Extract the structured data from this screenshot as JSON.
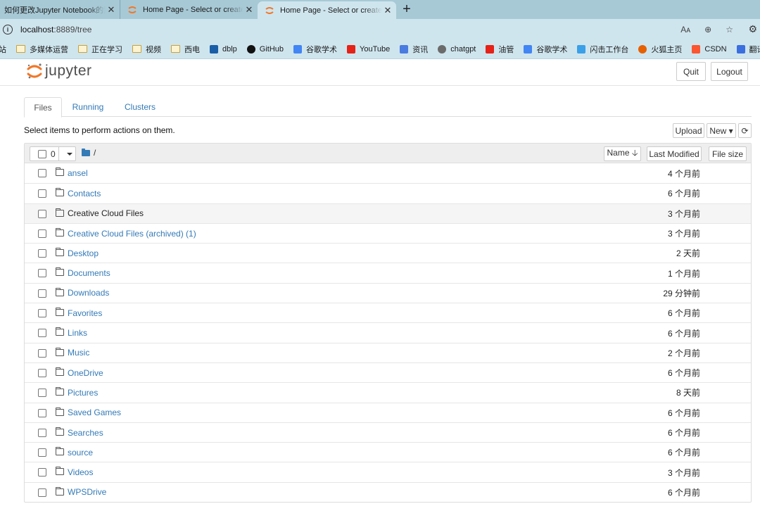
{
  "browser": {
    "tabs": [
      {
        "title": "如何更改Jupyter Notebook的默认",
        "active": false
      },
      {
        "title": "Home Page - Select or create a n",
        "active": false
      },
      {
        "title": "Home Page - Select or create a n",
        "active": true
      }
    ],
    "close_glyph": "✕",
    "new_tab_glyph": "+",
    "address": {
      "host": "localhost",
      "path": ":8889/tree"
    },
    "addr_icons": [
      "read-aloud-icon",
      "zoom-icon",
      "favorite-star-icon",
      "extensions-icon"
    ],
    "addr_glyphs": {
      "read_aloud": "Aᴀ",
      "zoom": "⊕",
      "favorite": "☆",
      "extensions": "⚙"
    },
    "bookmarks": [
      {
        "label": "站",
        "icon": "site-icon"
      },
      {
        "label": "多媒体运营",
        "icon": "folder-icon"
      },
      {
        "label": "正在学习",
        "icon": "folder-icon"
      },
      {
        "label": "视频",
        "icon": "folder-icon"
      },
      {
        "label": "西电",
        "icon": "folder-icon"
      },
      {
        "label": "dblp",
        "icon": "dblp-icon"
      },
      {
        "label": "GitHub",
        "icon": "github-icon"
      },
      {
        "label": "谷歌学术",
        "icon": "scholar-icon"
      },
      {
        "label": "YouTube",
        "icon": "youtube-icon"
      },
      {
        "label": "资讯",
        "icon": "news-icon"
      },
      {
        "label": "chatgpt",
        "icon": "chatgpt-icon"
      },
      {
        "label": "油管",
        "icon": "youtube-icon"
      },
      {
        "label": "谷歌学术",
        "icon": "scholar-icon"
      },
      {
        "label": "闪击工作台",
        "icon": "flash-icon"
      },
      {
        "label": "火狐主页",
        "icon": "firefox-icon"
      },
      {
        "label": "CSDN",
        "icon": "csdn-icon"
      },
      {
        "label": "翻译",
        "icon": "translate-icon"
      }
    ]
  },
  "header": {
    "logo_text": "jupyter",
    "quit_label": "Quit",
    "logout_label": "Logout"
  },
  "nav": {
    "files": "Files",
    "running": "Running",
    "clusters": "Clusters"
  },
  "toolbar": {
    "hint": "Select items to perform actions on them.",
    "upload_label": "Upload",
    "new_label": "New ▾",
    "refresh_glyph": "⟳"
  },
  "list_header": {
    "selected_count": "0",
    "breadcrumb": "/",
    "name_label": "Name 🡣",
    "last_modified_label": "Last Modified",
    "file_size_label": "File size"
  },
  "files": [
    {
      "name": "ansel",
      "modified": "4 个月前"
    },
    {
      "name": "Contacts",
      "modified": "6 个月前"
    },
    {
      "name": "Creative Cloud Files",
      "modified": "3 个月前"
    },
    {
      "name": "Creative Cloud Files (archived) (1)",
      "modified": "3 个月前"
    },
    {
      "name": "Desktop",
      "modified": "2 天前"
    },
    {
      "name": "Documents",
      "modified": "1 个月前"
    },
    {
      "name": "Downloads",
      "modified": "29 分钟前"
    },
    {
      "name": "Favorites",
      "modified": "6 个月前"
    },
    {
      "name": "Links",
      "modified": "6 个月前"
    },
    {
      "name": "Music",
      "modified": "2 个月前"
    },
    {
      "name": "OneDrive",
      "modified": "6 个月前"
    },
    {
      "name": "Pictures",
      "modified": "8 天前"
    },
    {
      "name": "Saved Games",
      "modified": "6 个月前"
    },
    {
      "name": "Searches",
      "modified": "6 个月前"
    },
    {
      "name": "source",
      "modified": "6 个月前"
    },
    {
      "name": "Videos",
      "modified": "3 个月前"
    },
    {
      "name": "WPSDrive",
      "modified": "6 个月前"
    }
  ],
  "colors": {
    "link": "#337ab7",
    "tabbar": "#a7c9d6",
    "toolbar": "#cfe5ee",
    "jupyter_orange": "#f37726"
  }
}
